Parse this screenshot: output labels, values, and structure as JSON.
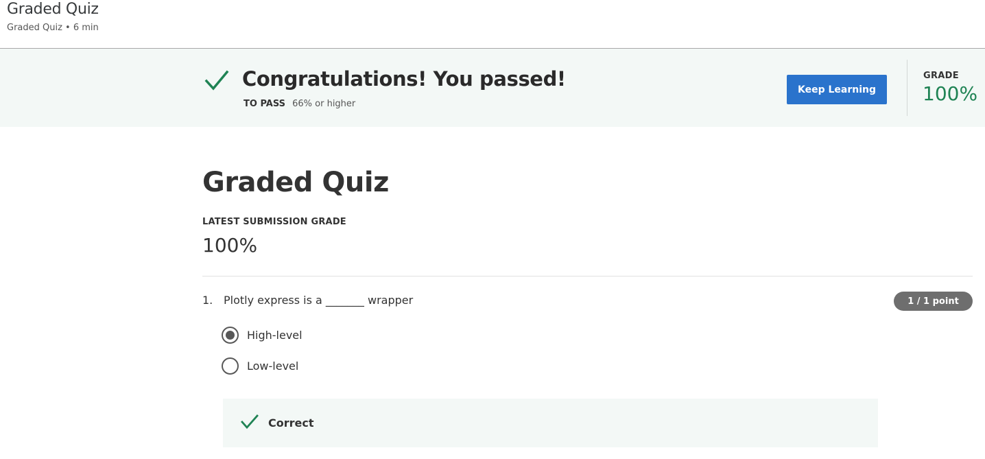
{
  "header": {
    "title": "Graded Quiz",
    "subtitle": "Graded Quiz • 6 min"
  },
  "banner": {
    "heading": "Congratulations! You passed!",
    "pass_label": "TO PASS",
    "pass_value": "66% or higher",
    "button_label": "Keep Learning",
    "grade_label": "GRADE",
    "grade_value": "100%",
    "icon": "checkmark-icon"
  },
  "quiz": {
    "title": "Graded Quiz",
    "latest_label": "LATEST SUBMISSION GRADE",
    "latest_value": "100%"
  },
  "question": {
    "number": "1.",
    "text": "Plotly express is a _______ wrapper",
    "points": "1 / 1 point",
    "options": [
      {
        "label": "High-level",
        "selected": true
      },
      {
        "label": "Low-level",
        "selected": false
      }
    ],
    "feedback": {
      "text": "Correct",
      "icon": "checkmark-icon"
    }
  },
  "colors": {
    "accent": "#2a73cc",
    "success": "#1f8354",
    "banner_bg": "#f3f8f6",
    "badge_bg": "#6e6e6e"
  }
}
